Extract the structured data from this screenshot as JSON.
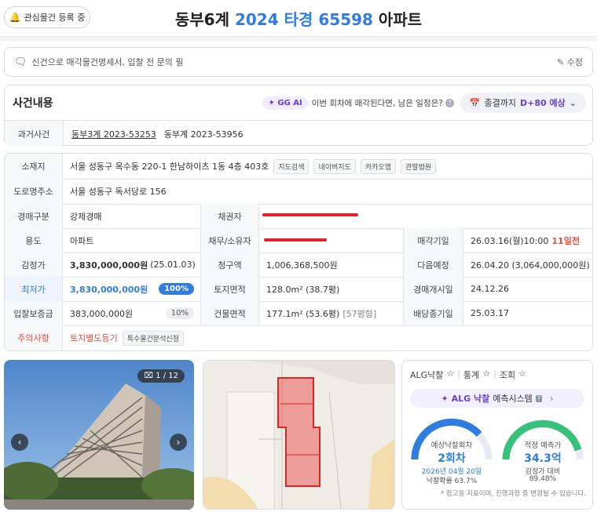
{
  "header": {
    "watch_label": "관심물건 등록 중",
    "title_prefix": "동부6계",
    "title_case": "2024 타경 65598",
    "title_suffix": "아파트"
  },
  "memo": {
    "placeholder": "신건으로 매각물건명세서, 입찰 전 문의 필",
    "edit_label": "수정"
  },
  "case": {
    "title": "사건내용",
    "gg_ai": "✦ GG AI",
    "ai_question": "이번 회차에 매각된다면, 남은 일정은?",
    "pred_label": "종결까지",
    "pred_value": "D+80 예상",
    "past_label": "과거사건",
    "past_case_1": "동부3계 2023-53253",
    "past_case_2": "동부계 2023-53956"
  },
  "info": {
    "location_label": "소재지",
    "location_value": "서울 성동구 옥수동 220-1 한남하이츠 1동 4층 403호",
    "loc_chips": [
      "지도검색",
      "네이버지도",
      "카카오맵",
      "관할법원"
    ],
    "road_label": "도로명주소",
    "road_value": "서울 성동구 독서당로 156",
    "auction_type_label": "경매구분",
    "auction_type_value": "강제경매",
    "creditor_label": "채권자",
    "usage_label": "용도",
    "usage_value": "아파트",
    "debtor_label": "채무/소유자",
    "sale_date_label": "매각기일",
    "sale_date_value": "26.03.16(월)10:00",
    "sale_date_dday": "11일전",
    "appraisal_label": "감정가",
    "appraisal_value": "3,830,000,000원",
    "appraisal_date": "(25.01.03)",
    "claim_label": "청구액",
    "claim_value": "1,006,368,500원",
    "next_label": "다음예정",
    "next_value": "26.04.20 (3,064,000,000원)",
    "min_label": "최저가",
    "min_value": "3,830,000,000원",
    "min_pct": "100%",
    "land_label": "토지면적",
    "land_value": "128.0m² (38.7평)",
    "start_label": "경매개시일",
    "start_value": "24.12.26",
    "deposit_label": "입찰보증금",
    "deposit_value": "383,000,000원",
    "deposit_pct": "10%",
    "bldg_label": "건물면적",
    "bldg_value": "177.1m² (53.6평)",
    "bldg_sub": "[57평형]",
    "dividend_label": "배당종기일",
    "dividend_value": "25.03.17",
    "caution_label": "주의사항",
    "caution_value": "토지별도등기",
    "caution_chip": "특수물건분석신청"
  },
  "photo": {
    "counter": "1 / 12"
  },
  "stats": {
    "tabs": [
      "ALG낙찰",
      "통계",
      "조회"
    ],
    "alg_brand": "✦ ALG 낙찰",
    "alg_rest": "예측시스템",
    "left_label": "예상낙찰회차",
    "left_value": "2회차",
    "left_date": "2026년 04월 20일",
    "left_sub": "낙찰확률 63.7%",
    "right_label": "적정 예측가",
    "right_value": "34.3억",
    "right_sub1": "감정가 대비",
    "right_sub2": "89.48%",
    "note": "* 참고용 지표이며, 진행과정 중 변경될 수 있습니다."
  },
  "colors": {
    "accent_blue": "#2f7de1",
    "accent_purple": "#6a3fd8",
    "alert_red": "#e84b3c",
    "gauge_green": "#36c27a"
  }
}
